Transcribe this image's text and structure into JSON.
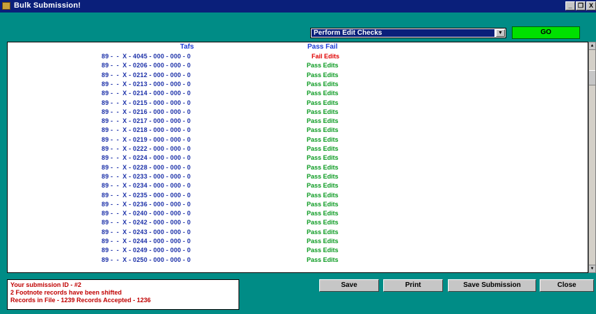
{
  "window": {
    "title": "Bulk Submission!",
    "buttons": {
      "minimize": "_",
      "restore": "❐",
      "close": "X"
    }
  },
  "toolbar": {
    "action_select": "Perform Edit Checks",
    "go_label": "GO"
  },
  "list": {
    "header_tafs": "Tafs",
    "header_status": "Pass Fail",
    "rows": [
      {
        "tafs": "89 -  -  X - 4045 - 000 - 000 - 0",
        "status": "Fail Edits"
      },
      {
        "tafs": "89 -  -  X - 0206 - 000 - 000 - 0",
        "status": "Pass Edits"
      },
      {
        "tafs": "89 -  -  X - 0212 - 000 - 000 - 0",
        "status": "Pass Edits"
      },
      {
        "tafs": "89 -  -  X - 0213 - 000 - 000 - 0",
        "status": "Pass Edits"
      },
      {
        "tafs": "89 -  -  X - 0214 - 000 - 000 - 0",
        "status": "Pass Edits"
      },
      {
        "tafs": "89 -  -  X - 0215 - 000 - 000 - 0",
        "status": "Pass Edits"
      },
      {
        "tafs": "89 -  -  X - 0216 - 000 - 000 - 0",
        "status": "Pass Edits"
      },
      {
        "tafs": "89 -  -  X - 0217 - 000 - 000 - 0",
        "status": "Pass Edits"
      },
      {
        "tafs": "89 -  -  X - 0218 - 000 - 000 - 0",
        "status": "Pass Edits"
      },
      {
        "tafs": "89 -  -  X - 0219 - 000 - 000 - 0",
        "status": "Pass Edits"
      },
      {
        "tafs": "89 -  -  X - 0222 - 000 - 000 - 0",
        "status": "Pass Edits"
      },
      {
        "tafs": "89 -  -  X - 0224 - 000 - 000 - 0",
        "status": "Pass Edits"
      },
      {
        "tafs": "89 -  -  X - 0228 - 000 - 000 - 0",
        "status": "Pass Edits"
      },
      {
        "tafs": "89 -  -  X - 0233 - 000 - 000 - 0",
        "status": "Pass Edits"
      },
      {
        "tafs": "89 -  -  X - 0234 - 000 - 000 - 0",
        "status": "Pass Edits"
      },
      {
        "tafs": "89 -  -  X - 0235 - 000 - 000 - 0",
        "status": "Pass Edits"
      },
      {
        "tafs": "89 -  -  X - 0236 - 000 - 000 - 0",
        "status": "Pass Edits"
      },
      {
        "tafs": "89 -  -  X - 0240 - 000 - 000 - 0",
        "status": "Pass Edits"
      },
      {
        "tafs": "89 -  -  X - 0242 - 000 - 000 - 0",
        "status": "Pass Edits"
      },
      {
        "tafs": "89 -  -  X - 0243 - 000 - 000 - 0",
        "status": "Pass Edits"
      },
      {
        "tafs": "89 -  -  X - 0244 - 000 - 000 - 0",
        "status": "Pass Edits"
      },
      {
        "tafs": "89 -  -  X - 0249 - 000 - 000 - 0",
        "status": "Pass Edits"
      },
      {
        "tafs": "89 -  -  X - 0250 - 000 - 000 - 0",
        "status": "Pass Edits"
      }
    ]
  },
  "messages": {
    "line1": "Your submission ID - #2",
    "line2": "2 Footnote records have been shifted",
    "line3": "Records in File - 1239  Records Accepted  - 1236"
  },
  "actions": {
    "save": "Save",
    "print": "Print",
    "save_submission": "Save Submission",
    "close": "Close"
  },
  "colors": {
    "background": "#008c86",
    "titlebar": "#0a1f7a",
    "pass": "#0a9a20",
    "fail": "#e00000",
    "go_button": "#00e000"
  }
}
